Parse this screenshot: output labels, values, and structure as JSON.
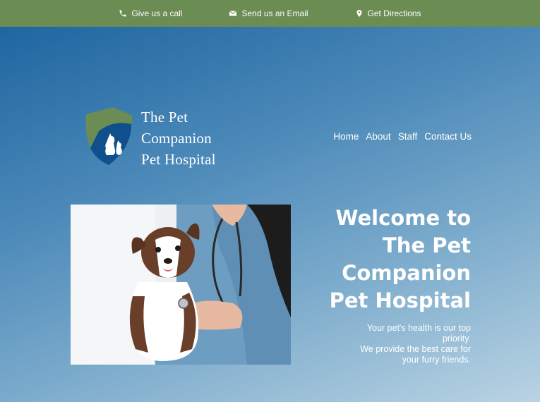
{
  "topbar": {
    "bg_color": "#6b8c52",
    "items": [
      {
        "icon": "phone-icon",
        "label": "Give us a call"
      },
      {
        "icon": "envelope-icon",
        "label": "Send us an Email"
      },
      {
        "icon": "map-pin-icon",
        "label": "Get Directions"
      }
    ]
  },
  "logo": {
    "lines": [
      "The Pet",
      "Companion",
      "Pet Hospital"
    ],
    "icon": "shield-pet-logo"
  },
  "nav": {
    "items": [
      "Home",
      "About",
      "Staff",
      "Contact Us"
    ]
  },
  "hero": {
    "headline_lines": [
      "Welcome to",
      "The Pet",
      "Companion",
      "Pet Hospital"
    ],
    "sub_lines": [
      "Your pet's health is our top",
      "priority.",
      "We provide the best care for",
      "your furry friends."
    ],
    "gradient_colors": [
      "#1f66a0",
      "#4a88b8",
      "#7aaacb",
      "#b9d3e3"
    ],
    "photo_subject": "vet-examining-puppy"
  }
}
